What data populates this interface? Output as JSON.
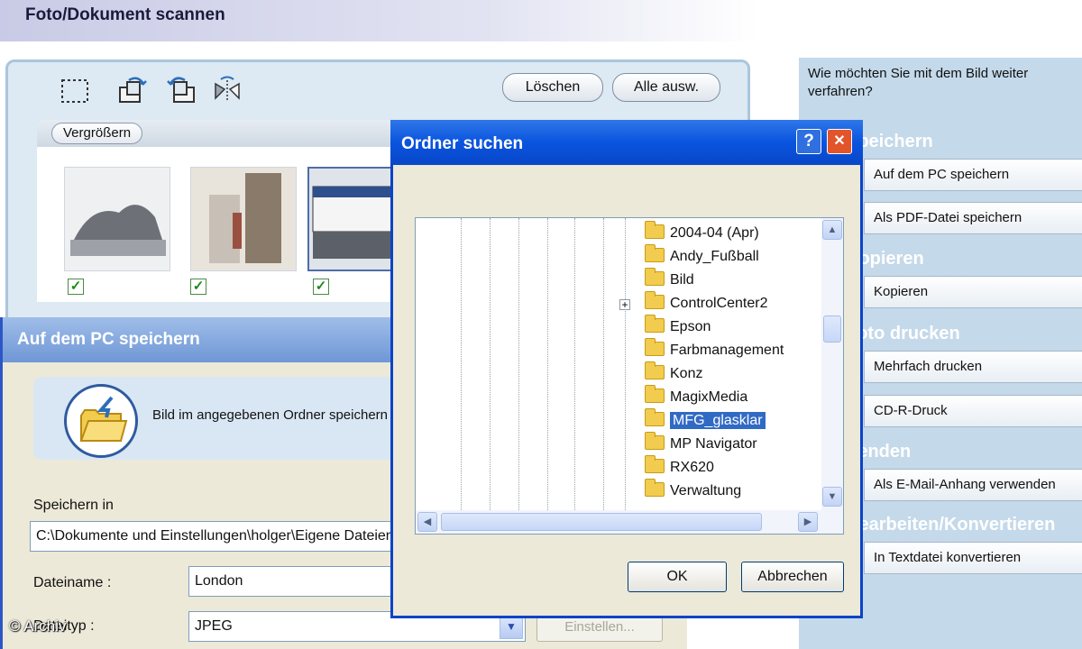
{
  "header": {
    "title": "Foto/Dokument scannen"
  },
  "scan_panel": {
    "tool_icons": [
      "select-area-icon",
      "rotate-right-icon",
      "rotate-left-icon",
      "flip-icon"
    ],
    "delete_label": "Löschen",
    "select_all_label": "Alle ausw.",
    "zoom_label": "Vergrößern",
    "thumbnails": [
      {
        "name": "lion-statue-photo",
        "checked": true
      },
      {
        "name": "street-photo",
        "checked": true
      },
      {
        "name": "sign-photo",
        "checked": true,
        "selected": true
      }
    ]
  },
  "right_panel": {
    "question": "Wie möchten Sie mit dem Bild weiter verfahren?",
    "sections": [
      {
        "heading": "Speichern",
        "buttons": [
          "Auf dem PC speichern",
          "Als PDF-Datei speichern"
        ]
      },
      {
        "heading": "Kopieren",
        "buttons": [
          "Kopieren"
        ]
      },
      {
        "heading": "Foto drucken",
        "buttons": [
          "Mehrfach drucken",
          "CD-R-Druck"
        ]
      },
      {
        "heading": "Senden",
        "buttons": [
          "Als E-Mail-Anhang verwenden"
        ]
      },
      {
        "heading": "Bearbeiten/Konvertieren",
        "buttons": [
          "In Textdatei konvertieren"
        ]
      }
    ]
  },
  "save_dialog": {
    "title": "Auf dem PC speichern",
    "info_text": "Bild im angegebenen Ordner speichern",
    "save_in_label": "Speichern in",
    "save_in_value": "C:\\Dokumente und Einstellungen\\holger\\Eigene Dateien",
    "filename_label": "Dateiname :",
    "filename_value": "London",
    "filetype_label": "Dateityp :",
    "filetype_value": "JPEG",
    "settings_label": "Einstellen..."
  },
  "folder_dialog": {
    "title": "Ordner suchen",
    "help_label": "?",
    "close_label": "✕",
    "folders": [
      {
        "name": "2004-04 (Apr)"
      },
      {
        "name": "Andy_Fußball"
      },
      {
        "name": "Bild"
      },
      {
        "name": "ControlCenter2",
        "expandable": true
      },
      {
        "name": "Epson"
      },
      {
        "name": "Farbmanagement"
      },
      {
        "name": "Konz"
      },
      {
        "name": "MagixMedia"
      },
      {
        "name": "MFG_glasklar",
        "selected": true
      },
      {
        "name": "MP Navigator"
      },
      {
        "name": "RX620"
      },
      {
        "name": "Verwaltung"
      }
    ],
    "ok_label": "OK",
    "cancel_label": "Abbrechen"
  },
  "watermark": "© Archiv",
  "colors": {
    "folder_title_blue": "#0a54df",
    "save_title_blue": "#6f97d6",
    "right_panel_bg": "#c4d9ea",
    "selection_blue": "#316ac5"
  }
}
